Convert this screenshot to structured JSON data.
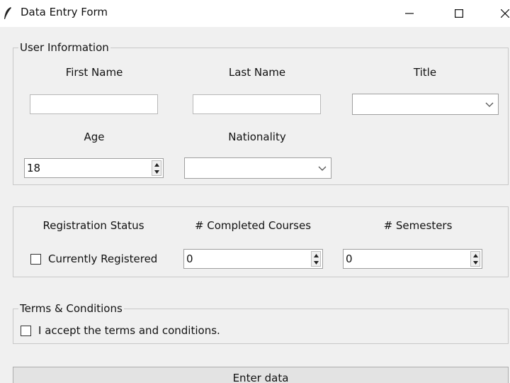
{
  "window": {
    "title": "Data Entry Form",
    "minimize_icon": "minimize-icon",
    "maximize_icon": "maximize-icon",
    "close_icon": "close-icon",
    "app_icon": "feather-icon"
  },
  "user_info": {
    "legend": "User Information",
    "first_name_label": "First Name",
    "first_name_value": "",
    "last_name_label": "Last Name",
    "last_name_value": "",
    "title_label": "Title",
    "title_value": "",
    "age_label": "Age",
    "age_value": "18",
    "nationality_label": "Nationality",
    "nationality_value": ""
  },
  "courses": {
    "registration_status_label": "Registration Status",
    "registered_checkbox_label": "Currently Registered",
    "registered_checked": false,
    "completed_courses_label": "# Completed Courses",
    "completed_courses_value": "0",
    "semesters_label": "# Semesters",
    "semesters_value": "0"
  },
  "terms": {
    "legend": "Terms & Conditions",
    "accept_label": "I accept the terms and conditions.",
    "accepted": false
  },
  "actions": {
    "enter_label": "Enter data"
  }
}
